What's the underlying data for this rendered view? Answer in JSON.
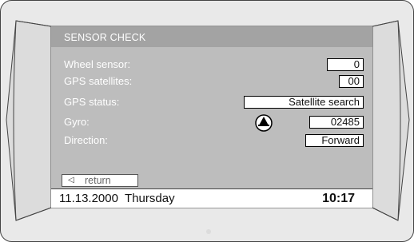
{
  "screen": {
    "title": "SENSOR CHECK",
    "rows": [
      {
        "label": "Wheel sensor:",
        "value": "0"
      },
      {
        "label": "GPS satellites:",
        "value": "00"
      },
      {
        "label": "GPS status:",
        "value": "Satellite search"
      },
      {
        "label": "Gyro:",
        "value": "02485",
        "icon": "gyro-dial-icon"
      },
      {
        "label": "Direction:",
        "value": "Forward"
      }
    ],
    "return_button": {
      "icon": "triangle-left-icon",
      "label": "return"
    },
    "status_bar": {
      "date": "11.13.2000",
      "day": "Thursday",
      "time": "10:17"
    }
  },
  "colors": {
    "bezel": "#e6e6e6",
    "screen_background": "#bdbdbd",
    "title_bar": "#a3a3a3",
    "label_text": "#ffffff"
  }
}
